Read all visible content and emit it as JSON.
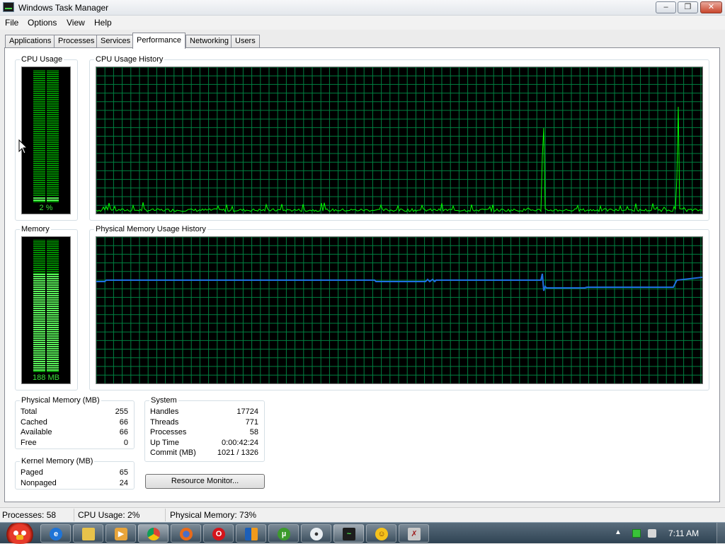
{
  "window": {
    "title": "Windows Task Manager"
  },
  "menu": [
    "File",
    "Options",
    "View",
    "Help"
  ],
  "tabs": [
    "Applications",
    "Processes",
    "Services",
    "Performance",
    "Networking",
    "Users"
  ],
  "active_tab": "Performance",
  "cpu": {
    "label": "CPU Usage",
    "value_text": "2 %",
    "level": 0.02
  },
  "cpu_history": {
    "label": "CPU Usage History"
  },
  "memory": {
    "label": "Memory",
    "value_text": "188 MB",
    "level": 0.73
  },
  "memory_history": {
    "label": "Physical Memory Usage History"
  },
  "physical_memory": {
    "label": "Physical Memory (MB)",
    "rows": [
      {
        "name": "Total",
        "value": "255"
      },
      {
        "name": "Cached",
        "value": "66"
      },
      {
        "name": "Available",
        "value": "66"
      },
      {
        "name": "Free",
        "value": "0"
      }
    ]
  },
  "kernel_memory": {
    "label": "Kernel Memory (MB)",
    "rows": [
      {
        "name": "Paged",
        "value": "65"
      },
      {
        "name": "Nonpaged",
        "value": "24"
      }
    ]
  },
  "system": {
    "label": "System",
    "rows": [
      {
        "name": "Handles",
        "value": "17724"
      },
      {
        "name": "Threads",
        "value": "771"
      },
      {
        "name": "Processes",
        "value": "58"
      },
      {
        "name": "Up Time",
        "value": "0:00:42:24"
      },
      {
        "name": "Commit (MB)",
        "value": "1021 / 1326"
      }
    ]
  },
  "resource_monitor_button": "Resource Monitor...",
  "status": {
    "processes": "Processes: 58",
    "cpu": "CPU Usage: 2%",
    "memory": "Physical Memory: 73%"
  },
  "taskbar": {
    "clock": "7:11 AM",
    "apps": [
      "ie-icon",
      "explorer-folder-icon",
      "media-player-icon",
      "chrome-icon",
      "firefox-icon",
      "opera-icon",
      "app-icon",
      "utorrent-icon",
      "chat-icon",
      "task-manager-icon",
      "messenger-icon",
      "tool-icon"
    ]
  },
  "colors": {
    "graph_bg": "#000000",
    "grid": "#008040",
    "cpu_line": "#00ff00",
    "memory_line": "#1e6fe0",
    "meter_on": "#59f159",
    "meter_off": "#008a00"
  }
}
